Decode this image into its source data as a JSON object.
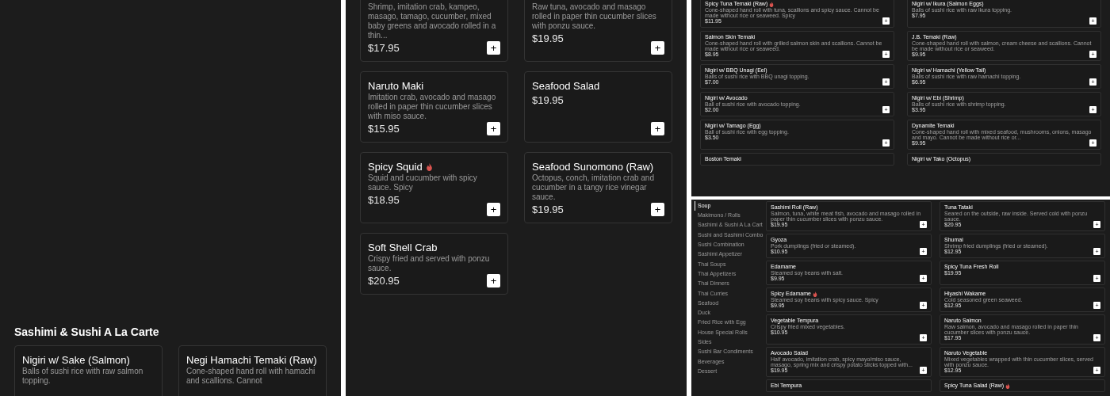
{
  "panels": [
    {
      "kind": "section",
      "heading": "Sashimi & Sushi A La Carte",
      "items": [
        {
          "title": "Nigiri w/ Sake (Salmon)",
          "spicy": false,
          "description": "Balls of sushi rice with raw salmon topping."
        },
        {
          "title": "Negi Hamachi Temaki (Raw)",
          "spicy": false,
          "description": "Cone-shaped hand roll with hamachi and scallions. Cannot"
        }
      ]
    },
    {
      "kind": "list",
      "items": [
        {
          "description": "Shrimp, imitation crab, kampeo, masago, tamago, cucumber, mixed baby greens and avocado rolled in a thin...",
          "price": "$17.95",
          "button": "+"
        },
        {
          "description": "Raw tuna, avocado and masago rolled in paper thin cucumber slices with ponzu sauce.",
          "price": "$19.95",
          "button": "+"
        },
        {
          "title": "Naruto Maki",
          "spicy": false,
          "description": "Imitation crab, avocado and masago rolled in paper thin cucumber slices with miso sauce.",
          "price": "$15.95",
          "button": "+"
        },
        {
          "title": "Seafood Salad",
          "spicy": false,
          "price": "$19.95",
          "button": "+"
        },
        {
          "title": "Spicy Squid",
          "spicy": true,
          "description": "Squid and cucumber with spicy sauce. Spicy",
          "price": "$18.95",
          "button": "+"
        },
        {
          "title": "Seafood Sunomono (Raw)",
          "spicy": false,
          "description": "Octopus, conch, imitation crab and cucumber in a tangy rice vinegar sauce.",
          "price": "$19.95",
          "button": "+"
        },
        {
          "title": "Soft Shell Crab",
          "spicy": false,
          "description": "Crispy fried and served with ponzu sauce.",
          "price": "$20.95",
          "button": "+"
        }
      ]
    },
    {
      "kind": "compact",
      "items": [
        {
          "title": "Spicy Tuna Temaki (Raw)",
          "spicy": true,
          "description": "Cone-shaped hand roll with tuna, scallions and spicy sauce. Cannot be made without rice or seaweed. Spicy",
          "price": "$11.95",
          "button": "+"
        },
        {
          "title": "Nigiri w/ Ikura (Salmon Eggs)",
          "spicy": false,
          "description": "Balls of sushi rice with raw ikura topping.",
          "price": "$7.95",
          "button": "+"
        },
        {
          "title": "Salmon Skin Temaki",
          "spicy": false,
          "description": "Cone-shaped hand roll with grilled salmon skin and scallions. Cannot be made without rice or seaweed.",
          "price": "$8.95",
          "button": "+"
        },
        {
          "title": "J.B. Temaki (Raw)",
          "spicy": false,
          "description": "Cone-shaped hand roll with salmon, cream cheese and scallions. Cannot be made without rice or seaweed.",
          "price": "$9.95",
          "button": "+"
        },
        {
          "title": "Nigiri w/ BBQ Unagi (Eel)",
          "spicy": false,
          "description": "Balls of sushi rice with BBQ unagi topping.",
          "price": "$7.00",
          "button": "+"
        },
        {
          "title": "Nigiri w/ Hamachi (Yellow Tail)",
          "spicy": false,
          "description": "Balls of sushi rice with raw hamachi topping.",
          "price": "$6.95",
          "button": "+"
        },
        {
          "title": "Nigiri w/ Avocado",
          "spicy": false,
          "description": "Ball of sushi rice with avocado topping.",
          "price": "$2.00",
          "button": "+"
        },
        {
          "title": "Nigiri w/ Ebi (Shrimp)",
          "spicy": false,
          "description": "Balls of sushi rice with shrimp topping.",
          "price": "$3.95",
          "button": "+"
        },
        {
          "title": "Nigiri w/ Tamago (Egg)",
          "spicy": false,
          "description": "Ball of sushi rice with egg topping.",
          "price": "$3.50",
          "button": "+"
        },
        {
          "title": "Dynamite Temaki",
          "spicy": false,
          "description": "Cone-shaped hand roll with mixed seafood, mushrooms, onions, masago and mayo. Cannot be made without rice or...",
          "price": "$9.95",
          "button": "+"
        },
        {
          "title": "Boston Temaki",
          "spicy": false
        },
        {
          "title": "Nigiri w/ Tako (Octopus)",
          "spicy": false
        }
      ]
    },
    {
      "kind": "sidebar",
      "categories": [
        {
          "label": "Soup",
          "selected": true
        },
        {
          "label": "Makimono / Rolls",
          "selected": false
        },
        {
          "label": "Sashimi & Sushi A La Cart",
          "selected": false
        },
        {
          "label": "Sushi and Sashimi Combo",
          "selected": false
        },
        {
          "label": "Sushi Combination",
          "selected": false
        },
        {
          "label": "Sashimi Appetizer",
          "selected": false
        },
        {
          "label": "Thai Soups",
          "selected": false
        },
        {
          "label": "Thai Appetizers",
          "selected": false
        },
        {
          "label": "Thai Dinners",
          "selected": false
        },
        {
          "label": "Thai Curries",
          "selected": false
        },
        {
          "label": "Seafood",
          "selected": false
        },
        {
          "label": "Duck",
          "selected": false
        },
        {
          "label": "Fried Rice with Egg",
          "selected": false
        },
        {
          "label": "House Special Rolls",
          "selected": false
        },
        {
          "label": "Sides",
          "selected": false
        },
        {
          "label": "Sushi Bar Condiments",
          "selected": false
        },
        {
          "label": "Beverages",
          "selected": false
        },
        {
          "label": "Dessert",
          "selected": false
        }
      ],
      "items": [
        {
          "title": "Sashimi Roll (Raw)",
          "spicy": false,
          "description": "Salmon, tuna, white meat fish, avocado and masago rolled in paper thin cucumber slices with ponzu sauce.",
          "price": "$19.95",
          "button": "+"
        },
        {
          "title": "Tuna Tataki",
          "spicy": false,
          "description": "Seared on the outside, raw inside. Served cold with ponzu sauce.",
          "price": "$20.95",
          "button": "+"
        },
        {
          "title": "Gyoza",
          "spicy": false,
          "description": "Pork dumplings (fried or steamed).",
          "price": "$10.95",
          "button": "+"
        },
        {
          "title": "Shumai",
          "spicy": false,
          "description": "Shrimp fried dumplings (fried or steamed).",
          "price": "$12.95",
          "button": "+"
        },
        {
          "title": "Edamame",
          "spicy": false,
          "description": "Steamed soy beans with salt.",
          "price": "$9.95",
          "button": "+"
        },
        {
          "title": "Spicy Tuna Fresh Roll",
          "spicy": false,
          "price": "$19.95",
          "button": "+"
        },
        {
          "title": "Spicy Edamame",
          "spicy": true,
          "description": "Steamed soy beans with spicy sauce. Spicy",
          "price": "$9.95",
          "button": "+"
        },
        {
          "title": "Hiyashi Wakame",
          "spicy": false,
          "description": "Cold seasoned green seaweed.",
          "price": "$12.95",
          "button": "+"
        },
        {
          "title": "Vegetable Tempura",
          "spicy": false,
          "description": "Crispy fried mixed vegetables.",
          "price": "$10.95",
          "button": "+"
        },
        {
          "title": "Naruto Salmon",
          "spicy": false,
          "description": "Raw salmon, avocado and masago rolled in paper thin cucumber slices with ponzu sauce.",
          "price": "$17.95",
          "button": "+"
        },
        {
          "title": "Avocado Salad",
          "spicy": false,
          "description": "Half avocado, imitation crab, spicy mayo/miso sauce, masago, spring mix and crispy potato sticks topped with...",
          "price": "$19.95",
          "button": "+"
        },
        {
          "title": "Naruto Vegetable",
          "spicy": false,
          "description": "Mixed vegetables wrapped with thin cucumber slices, served with ponzu sauce.",
          "price": "$12.95",
          "button": "+"
        },
        {
          "title": "Ebi Tempura",
          "spicy": false
        },
        {
          "title": "Spicy Tuna Salad (Raw)",
          "spicy": true
        }
      ]
    }
  ]
}
